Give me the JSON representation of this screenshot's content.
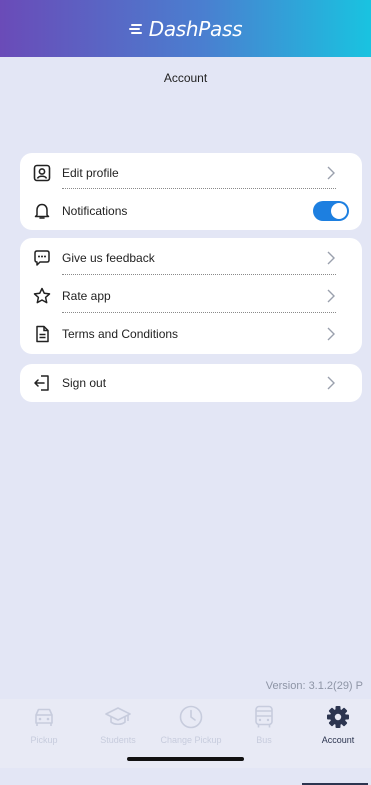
{
  "app": {
    "brand": "DashPass",
    "page_title": "Account"
  },
  "sections": {
    "profile": {
      "edit_profile": "Edit profile",
      "notifications": "Notifications",
      "notifications_enabled": true
    },
    "support": {
      "feedback": "Give us feedback",
      "rate": "Rate app",
      "terms": "Terms and Conditions"
    },
    "session": {
      "sign_out": "Sign out"
    }
  },
  "version": "Version:  3.1.2(29) P",
  "tabs": [
    {
      "label": "Pickup",
      "icon": "car-icon",
      "active": false
    },
    {
      "label": "Students",
      "icon": "graduation-cap-icon",
      "active": false
    },
    {
      "label": "Change Pickup",
      "icon": "clock-icon",
      "active": false
    },
    {
      "label": "Bus",
      "icon": "bus-icon",
      "active": false
    },
    {
      "label": "Account",
      "icon": "gear-icon",
      "active": true
    }
  ],
  "colors": {
    "accent": "#1d7fe0",
    "header_start": "#6a4bb8",
    "header_end": "#19c3e0",
    "background": "#e3e6f5"
  }
}
